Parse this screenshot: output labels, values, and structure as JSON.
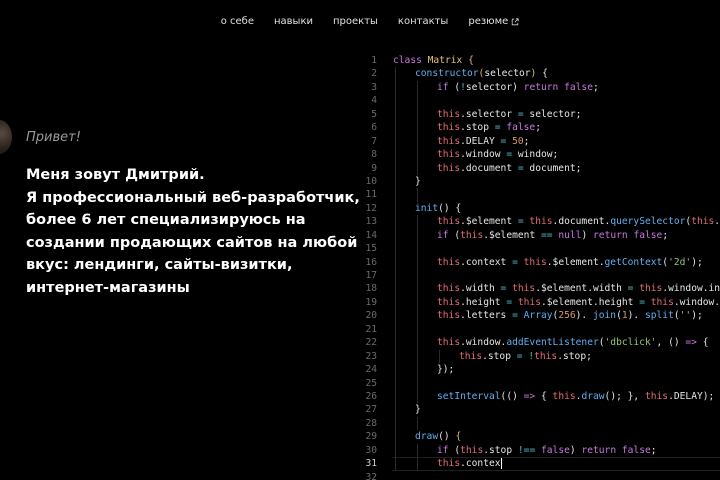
{
  "nav": {
    "items": [
      {
        "label": "о себе"
      },
      {
        "label": "навыки"
      },
      {
        "label": "проекты"
      },
      {
        "label": "контакты"
      },
      {
        "label": "резюме",
        "icon": "external-link-icon"
      }
    ]
  },
  "hero": {
    "greeting": "Привет!",
    "lines": [
      "Меня зовут Дмитрий.",
      "Я профессиональный веб-разработчик,",
      "более 6 лет специализируюсь на",
      "создании продающих сайтов на любой",
      "вкус: лендинги, сайты-визитки,",
      "интернет-магазины"
    ]
  },
  "code": {
    "active_line": 31,
    "lines": [
      {
        "n": "1",
        "indent": 0,
        "tokens": [
          [
            "kw",
            "class "
          ],
          [
            "cls",
            "Matrix"
          ],
          [
            "br",
            " {"
          ]
        ]
      },
      {
        "n": "2",
        "indent": 1,
        "tokens": [
          [
            "fn",
            "constructor"
          ],
          [
            "br",
            "("
          ],
          [
            "",
            "selector"
          ],
          [
            "br",
            ")"
          ],
          [
            "",
            " {"
          ]
        ]
      },
      {
        "n": "3",
        "indent": 2,
        "tokens": [
          [
            "kw",
            "if"
          ],
          [
            "",
            " ("
          ],
          [
            "op",
            "!"
          ],
          [
            "",
            "selector) "
          ],
          [
            "kw",
            "return"
          ],
          [
            "kw",
            " false"
          ],
          [
            "",
            ";"
          ]
        ]
      },
      {
        "n": "4",
        "indent": 0,
        "tokens": []
      },
      {
        "n": "5",
        "indent": 2,
        "tokens": [
          [
            "this",
            "this"
          ],
          [
            "",
            ".selector "
          ],
          [
            "op",
            "="
          ],
          [
            "",
            " selector;"
          ]
        ]
      },
      {
        "n": "6",
        "indent": 2,
        "tokens": [
          [
            "this",
            "this"
          ],
          [
            "",
            ".stop "
          ],
          [
            "op",
            "="
          ],
          [
            "kw",
            " false"
          ],
          [
            "",
            ";"
          ]
        ]
      },
      {
        "n": "7",
        "indent": 2,
        "tokens": [
          [
            "this",
            "this"
          ],
          [
            "",
            ".DELAY "
          ],
          [
            "op",
            "="
          ],
          [
            "num",
            " 50"
          ],
          [
            "",
            ";"
          ]
        ]
      },
      {
        "n": "8",
        "indent": 2,
        "tokens": [
          [
            "this",
            "this"
          ],
          [
            "",
            ".window "
          ],
          [
            "op",
            "="
          ],
          [
            "",
            " window;"
          ]
        ]
      },
      {
        "n": "9",
        "indent": 2,
        "tokens": [
          [
            "this",
            "this"
          ],
          [
            "",
            ".document "
          ],
          [
            "op",
            "="
          ],
          [
            "",
            " document;"
          ]
        ]
      },
      {
        "n": "10",
        "indent": 1,
        "tokens": [
          [
            "",
            "}"
          ]
        ]
      },
      {
        "n": "11",
        "indent": 0,
        "tokens": []
      },
      {
        "n": "12",
        "indent": 1,
        "tokens": [
          [
            "fn",
            "init"
          ],
          [
            "",
            "() {"
          ]
        ]
      },
      {
        "n": "13",
        "indent": 2,
        "tokens": [
          [
            "this",
            "this"
          ],
          [
            "",
            ".$element "
          ],
          [
            "op",
            "="
          ],
          [
            "this",
            " this"
          ],
          [
            "",
            ".document."
          ],
          [
            "fn",
            "querySelector"
          ],
          [
            "",
            "("
          ],
          [
            "this",
            "this"
          ],
          [
            "",
            ".selector);"
          ]
        ]
      },
      {
        "n": "14",
        "indent": 2,
        "tokens": [
          [
            "kw",
            "if"
          ],
          [
            "",
            " ("
          ],
          [
            "this",
            "this"
          ],
          [
            "",
            ".$element "
          ],
          [
            "op",
            "=="
          ],
          [
            "kw",
            " null"
          ],
          [
            "",
            ") "
          ],
          [
            "kw",
            "return"
          ],
          [
            "kw",
            " false"
          ],
          [
            "",
            ";"
          ]
        ]
      },
      {
        "n": "15",
        "indent": 0,
        "tokens": []
      },
      {
        "n": "16",
        "indent": 2,
        "tokens": [
          [
            "this",
            "this"
          ],
          [
            "",
            ".context "
          ],
          [
            "op",
            "="
          ],
          [
            "this",
            " this"
          ],
          [
            "",
            ".$element."
          ],
          [
            "fn",
            "getContext"
          ],
          [
            "",
            "("
          ],
          [
            "str",
            "'2d'"
          ],
          [
            "",
            ");"
          ]
        ]
      },
      {
        "n": "17",
        "indent": 0,
        "tokens": []
      },
      {
        "n": "18",
        "indent": 2,
        "tokens": [
          [
            "this",
            "this"
          ],
          [
            "",
            ".width "
          ],
          [
            "op",
            "="
          ],
          [
            "this",
            " this"
          ],
          [
            "",
            ".$element.width "
          ],
          [
            "op",
            "="
          ],
          [
            "this",
            " this"
          ],
          [
            "",
            ".window.innerWidth;"
          ]
        ]
      },
      {
        "n": "19",
        "indent": 2,
        "tokens": [
          [
            "this",
            "this"
          ],
          [
            "",
            ".height "
          ],
          [
            "op",
            "="
          ],
          [
            "this",
            " this"
          ],
          [
            "",
            ".$element.height "
          ],
          [
            "op",
            "="
          ],
          [
            "this",
            " this"
          ],
          [
            "",
            ".window.innerHeight;"
          ]
        ]
      },
      {
        "n": "20",
        "indent": 2,
        "tokens": [
          [
            "this",
            "this"
          ],
          [
            "",
            ".letters "
          ],
          [
            "op",
            "="
          ],
          [
            "fn",
            " Array"
          ],
          [
            "",
            "("
          ],
          [
            "num",
            "256"
          ],
          [
            "",
            "). "
          ],
          [
            "fn",
            "join"
          ],
          [
            "",
            "("
          ],
          [
            "num",
            "1"
          ],
          [
            "",
            "). "
          ],
          [
            "fn",
            "split"
          ],
          [
            "",
            "("
          ],
          [
            "str",
            "''"
          ],
          [
            "",
            ");"
          ]
        ]
      },
      {
        "n": "21",
        "indent": 0,
        "tokens": []
      },
      {
        "n": "22",
        "indent": 2,
        "tokens": [
          [
            "this",
            "this"
          ],
          [
            "",
            ".window."
          ],
          [
            "fn",
            "addEventListener"
          ],
          [
            "",
            "("
          ],
          [
            "str",
            "'dbclick'"
          ],
          [
            "",
            ", () "
          ],
          [
            "kw",
            "=>"
          ],
          [
            "",
            " {"
          ]
        ]
      },
      {
        "n": "23",
        "indent": 3,
        "tokens": [
          [
            "this",
            "this"
          ],
          [
            "",
            ".stop "
          ],
          [
            "op",
            "="
          ],
          [
            "op",
            " !"
          ],
          [
            "this",
            "this"
          ],
          [
            "",
            ".stop;"
          ]
        ]
      },
      {
        "n": "24",
        "indent": 2,
        "tokens": [
          [
            "",
            "});"
          ]
        ]
      },
      {
        "n": "25",
        "indent": 0,
        "tokens": []
      },
      {
        "n": "26",
        "indent": 2,
        "tokens": [
          [
            "fn",
            "setInterval"
          ],
          [
            "",
            "(() "
          ],
          [
            "kw",
            "=>"
          ],
          [
            "",
            " { "
          ],
          [
            "this",
            "this"
          ],
          [
            "",
            "."
          ],
          [
            "fn",
            "draw"
          ],
          [
            "",
            "(); }, "
          ],
          [
            "this",
            "this"
          ],
          [
            "",
            ".DELAY);"
          ]
        ]
      },
      {
        "n": "27",
        "indent": 1,
        "tokens": [
          [
            "",
            "}"
          ]
        ]
      },
      {
        "n": "28",
        "indent": 0,
        "tokens": []
      },
      {
        "n": "29",
        "indent": 1,
        "tokens": [
          [
            "fn",
            "draw"
          ],
          [
            "",
            "() "
          ],
          [
            "br",
            "{"
          ]
        ]
      },
      {
        "n": "30",
        "indent": 2,
        "tokens": [
          [
            "kw",
            "if"
          ],
          [
            "",
            " ("
          ],
          [
            "this",
            "this"
          ],
          [
            "",
            ".stop "
          ],
          [
            "op",
            "!=="
          ],
          [
            "kw",
            " false"
          ],
          [
            "",
            ") "
          ],
          [
            "kw",
            "return"
          ],
          [
            "kw",
            " false"
          ],
          [
            "",
            ";"
          ]
        ]
      },
      {
        "n": "31",
        "indent": 2,
        "tokens": [
          [
            "this",
            "this"
          ],
          [
            "",
            ".contex"
          ]
        ],
        "caret": true
      },
      {
        "n": "32",
        "indent": 0,
        "tokens": []
      }
    ]
  }
}
